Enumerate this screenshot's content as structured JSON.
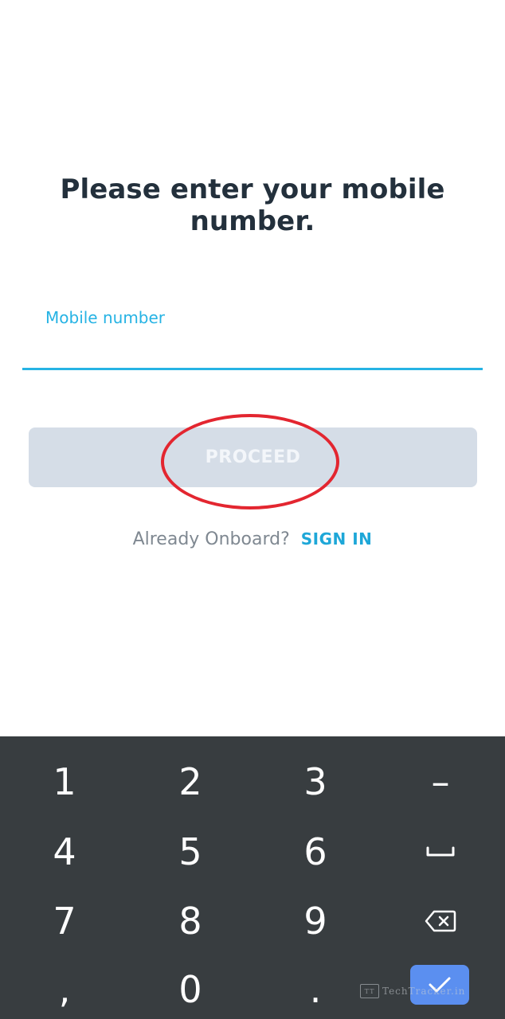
{
  "page": {
    "heading": "Please enter your mobile number."
  },
  "mobile_field": {
    "label": "Mobile number",
    "value": ""
  },
  "proceed_button": {
    "label": "PROCEED"
  },
  "onboard": {
    "text": "Already Onboard?",
    "signin_label": "SIGN IN"
  },
  "keypad": {
    "keys": [
      "1",
      "2",
      "3",
      "–",
      "4",
      "5",
      "6",
      "space-icon",
      "7",
      "8",
      "9",
      "backspace-icon",
      ",",
      "0",
      ".",
      "check-icon"
    ]
  },
  "watermark": {
    "logo_text": "TT",
    "text": "TechTracker.in"
  },
  "colors": {
    "accent": "#26b3e4",
    "heading": "#23303c",
    "button_disabled": "#d5dde7",
    "highlight_ring": "#e32630",
    "keypad_bg": "#383d40",
    "done_key": "#5b8ff0"
  }
}
